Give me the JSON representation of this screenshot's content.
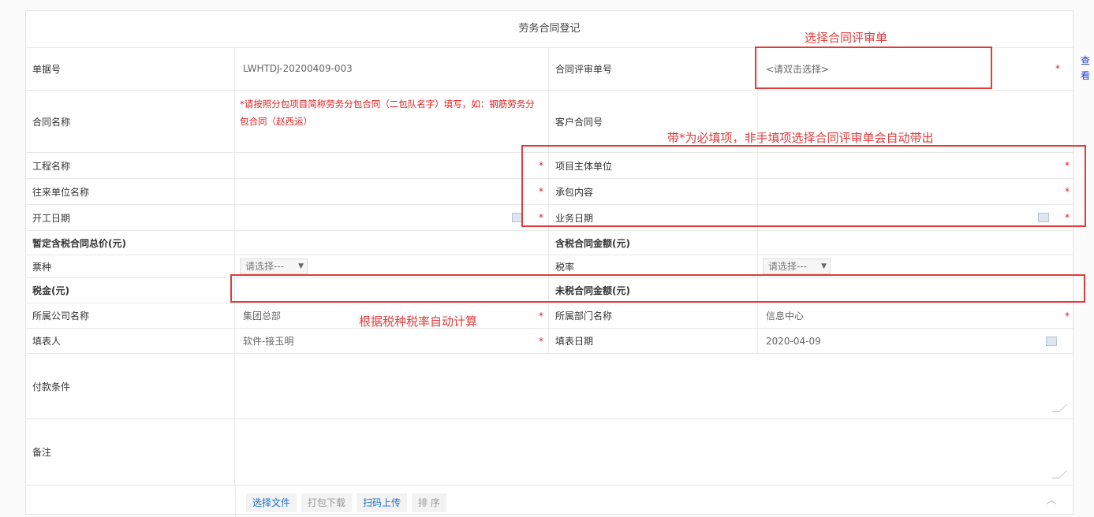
{
  "form": {
    "title": "劳务合同登记",
    "rows": [
      {
        "label_1": "单据号",
        "value_1": "LWHTDJ-20200409-003",
        "label_2": "合同评审单号",
        "value_2": "<请双击选择>"
      },
      {
        "label_1": "合同名称",
        "hint_1": "*请按照分包项目简称劳务分包合同（二包队名字）填写，如：钢筋劳务分包合同（赵西运）",
        "label_2": "客户合同号"
      },
      {
        "label_1": "工程名称",
        "label_2": "项目主体单位"
      },
      {
        "label_1": "往来单位名称",
        "label_2": "承包内容"
      },
      {
        "label_1": "开工日期",
        "label_2": "业务日期"
      },
      {
        "label_1": "暂定含税合同总价(元)",
        "label_2": "含税合同金额(元)"
      },
      {
        "label_1": "票种",
        "select_1": "请选择---",
        "label_2": "税率",
        "select_2": "请选择---"
      },
      {
        "label_1": "税金(元)",
        "label_2": "未税合同金额(元)"
      },
      {
        "label_1": "所属公司名称",
        "value_1": "集团总部",
        "label_2": "所属部门名称",
        "value_2": "信息中心"
      },
      {
        "label_1": "填表人",
        "value_1": "软件-接玉明",
        "label_2": "填表日期",
        "value_2": "2020-04-09"
      },
      {
        "label_1": "付款条件"
      },
      {
        "label_1": "备注"
      }
    ],
    "required_mark": "*",
    "view_link": "查看"
  },
  "toolbar": {
    "select_file": "选择文件",
    "pack_download": "打包下载",
    "scan_upload": "扫码上传",
    "sort": "排 序"
  },
  "annotations": {
    "select_review": "选择合同评审单",
    "required_note": "带*为必填项，非手填项选择合同评审单会自动带出",
    "auto_calc": "根据税种税率自动计算"
  },
  "colors": {
    "annotation": "#e23b3b",
    "required": "#e02020",
    "link": "#1a3cd1"
  }
}
